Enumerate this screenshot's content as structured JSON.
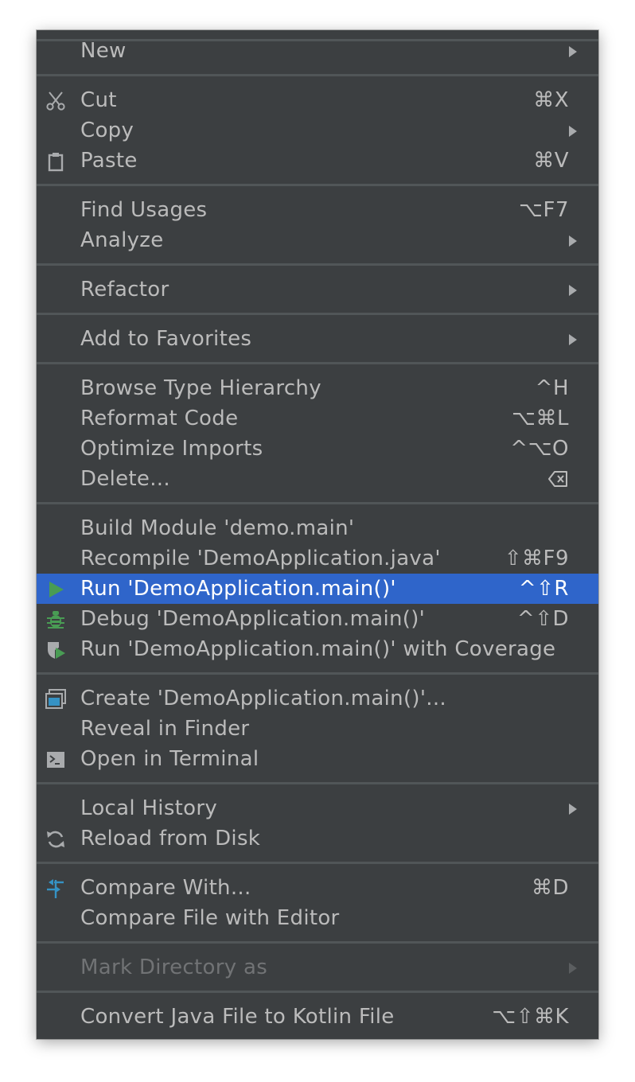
{
  "menu": {
    "new": {
      "label": "New"
    },
    "cut": {
      "label": "Cut",
      "shortcut": "⌘X",
      "icon": "scissors-icon"
    },
    "copy": {
      "label": "Copy"
    },
    "paste": {
      "label": "Paste",
      "shortcut": "⌘V",
      "icon": "clipboard-icon"
    },
    "find_usages": {
      "label": "Find Usages",
      "shortcut": "⌥F7"
    },
    "analyze": {
      "label": "Analyze"
    },
    "refactor": {
      "label": "Refactor"
    },
    "add_to_favorites": {
      "label": "Add to Favorites"
    },
    "browse_type_hierarchy": {
      "label": "Browse Type Hierarchy",
      "shortcut": "^H"
    },
    "reformat_code": {
      "label": "Reformat Code",
      "shortcut": "⌥⌘L"
    },
    "optimize_imports": {
      "label": "Optimize Imports",
      "shortcut": "^⌥O"
    },
    "delete": {
      "label": "Delete...",
      "shortcut_icon": "delete-key-icon"
    },
    "build_module": {
      "label": "Build Module 'demo.main'"
    },
    "recompile": {
      "label": "Recompile 'DemoApplication.java'",
      "shortcut": "⇧⌘F9"
    },
    "run": {
      "label": "Run 'DemoApplication.main()'",
      "shortcut": "^⇧R",
      "icon": "run-icon"
    },
    "debug": {
      "label": "Debug 'DemoApplication.main()'",
      "shortcut": "^⇧D",
      "icon": "debug-bug-icon"
    },
    "run_coverage": {
      "label": "Run 'DemoApplication.main()' with Coverage",
      "icon": "coverage-shield-icon"
    },
    "create_config": {
      "label": "Create 'DemoApplication.main()'...",
      "icon": "run-config-window-icon"
    },
    "reveal_in_finder": {
      "label": "Reveal in Finder"
    },
    "open_in_terminal": {
      "label": "Open in Terminal",
      "icon": "terminal-icon"
    },
    "local_history": {
      "label": "Local History"
    },
    "reload_from_disk": {
      "label": "Reload from Disk",
      "icon": "reload-icon"
    },
    "compare_with": {
      "label": "Compare With...",
      "shortcut": "⌘D",
      "icon": "compare-arrows-icon"
    },
    "compare_file_with_editor": {
      "label": "Compare File with Editor"
    },
    "mark_directory_as": {
      "label": "Mark Directory as",
      "disabled": true
    },
    "convert_to_kotlin": {
      "label": "Convert Java File to Kotlin File",
      "shortcut": "⌥⇧⌘K"
    }
  },
  "colors": {
    "menu_background": "#3c3f41",
    "selection": "#2f65ca",
    "text": "#bbbbbb",
    "disabled_text": "#717375",
    "separator": "#515658",
    "run_green": "#499c54",
    "compare_blue": "#3592c4"
  }
}
